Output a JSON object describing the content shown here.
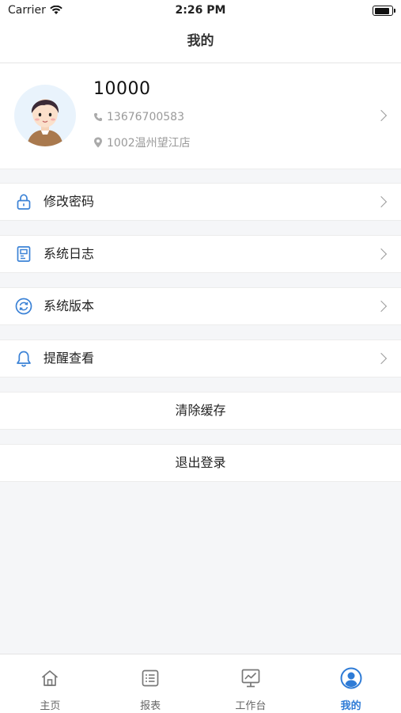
{
  "status_bar": {
    "carrier": "Carrier",
    "time": "2:26 PM"
  },
  "nav": {
    "title": "我的"
  },
  "profile": {
    "user_id": "10000",
    "phone": "13676700583",
    "store": "1002温州望江店"
  },
  "menu": [
    {
      "label": "修改密码",
      "icon": "lock-icon"
    },
    {
      "label": "系统日志",
      "icon": "document-icon"
    },
    {
      "label": "系统版本",
      "icon": "refresh-icon"
    },
    {
      "label": "提醒查看",
      "icon": "bell-icon"
    }
  ],
  "actions": {
    "clear_cache": "清除缓存",
    "logout": "退出登录"
  },
  "tabs": [
    {
      "label": "主页",
      "icon": "home-icon"
    },
    {
      "label": "报表",
      "icon": "list-icon"
    },
    {
      "label": "工作台",
      "icon": "monitor-icon"
    },
    {
      "label": "我的",
      "icon": "user-icon",
      "active": true
    }
  ],
  "colors": {
    "accent": "#2e7bd6",
    "icon_blue": "#3b82d6",
    "text_gray": "#9a9a9a"
  }
}
